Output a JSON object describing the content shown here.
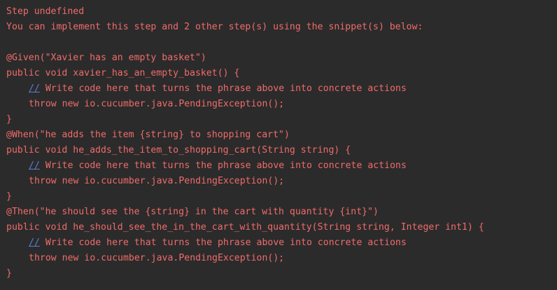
{
  "console": {
    "header": [
      "Step undefined",
      "You can implement this step and 2 other step(s) using the snippet(s) below:"
    ],
    "snippets": [
      {
        "annotation": "@Given(\"Xavier has an empty basket\")",
        "signature": "public void xavier_has_an_empty_basket() {",
        "comment_mark": "//",
        "comment": " Write code here that turns the phrase above into concrete actions",
        "throw": "throw new io.cucumber.java.PendingException();",
        "close": "}"
      },
      {
        "annotation": "@When(\"he adds the item {string} to shopping cart\")",
        "signature": "public void he_adds_the_item_to_shopping_cart(String string) {",
        "comment_mark": "//",
        "comment": " Write code here that turns the phrase above into concrete actions",
        "throw": "throw new io.cucumber.java.PendingException();",
        "close": "}"
      },
      {
        "annotation": "@Then(\"he should see the {string} in the cart with quantity {int}\")",
        "signature": "public void he_should_see_the_in_the_cart_with_quantity(String string, Integer int1) {",
        "comment_mark": "//",
        "comment": " Write code here that turns the phrase above into concrete actions",
        "throw": "throw new io.cucumber.java.PendingException();",
        "close": "}"
      }
    ]
  },
  "colors": {
    "background": "#2b2b2b",
    "error_text": "#f06b6b",
    "comment_mark": "#5b7dd6"
  }
}
